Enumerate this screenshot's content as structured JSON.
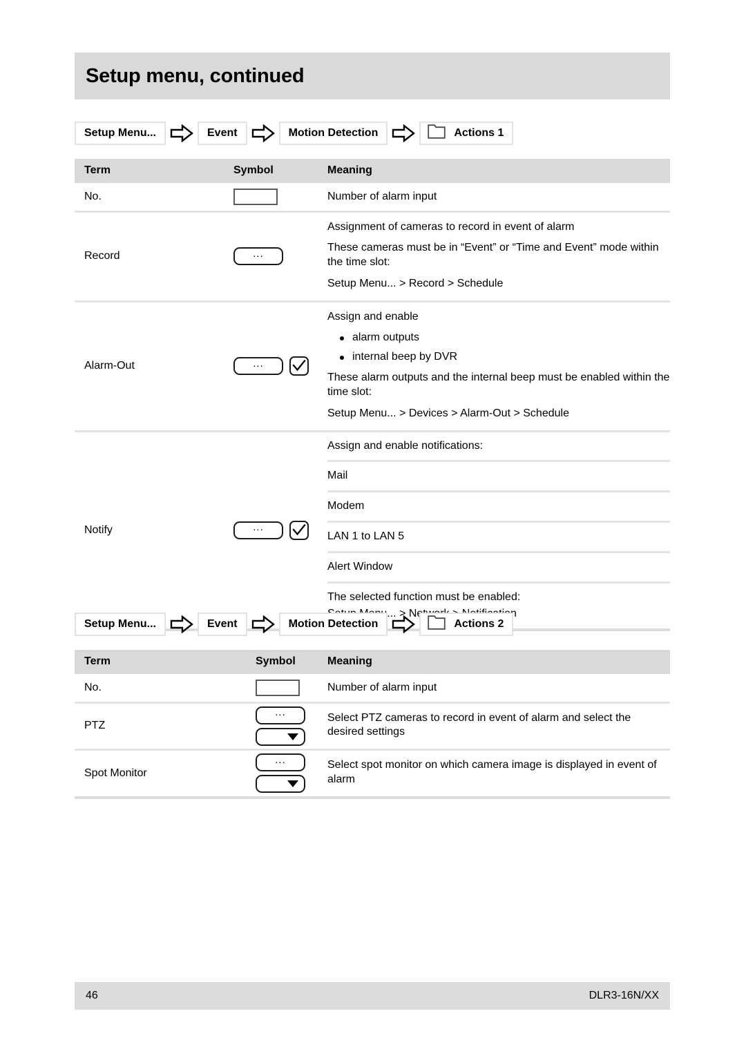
{
  "header": {
    "title": "Setup menu, continued"
  },
  "sections": [
    {
      "breadcrumb": [
        {
          "label": "Setup Menu...",
          "icon": null
        },
        {
          "label": "Event",
          "icon": null
        },
        {
          "label": "Motion Detection",
          "icon": null
        },
        {
          "label": "Actions 1",
          "icon": "folder-icon"
        }
      ],
      "columns": [
        "Term",
        "Symbol",
        "Meaning"
      ],
      "rows": [
        {
          "term": "No.",
          "symbol": [
            "box"
          ],
          "meaning_lines": [
            "Number of alarm input"
          ]
        },
        {
          "term": "Record",
          "symbol": [
            "dots"
          ],
          "meaning_lines": [
            "Assignment of cameras to record in event of alarm",
            "These cameras must be in “Event” or “Time and Event” mode within the time slot:",
            "Setup Menu... > Record > Schedule"
          ]
        },
        {
          "term": "Alarm-Out",
          "symbol": [
            "dots",
            "check"
          ],
          "meaning_lines": [
            "Assign and enable"
          ],
          "bullets": [
            "alarm outputs",
            "internal beep by DVR"
          ],
          "meaning_lines_after": [
            "These alarm outputs and the internal beep must be enabled within the time slot:",
            "Setup Menu... > Devices > Alarm-Out > Schedule"
          ]
        },
        {
          "term": "Notify",
          "symbol": [
            "dots",
            "check"
          ],
          "sub_rows": [
            "Assign and enable notifications:",
            "Mail",
            "Modem",
            "LAN 1 to LAN 5",
            "Alert Window"
          ],
          "sub_footer": [
            "The selected function must be enabled:",
            "Setup Menu... > Network > Notification"
          ]
        }
      ]
    },
    {
      "breadcrumb": [
        {
          "label": "Setup Menu...",
          "icon": null
        },
        {
          "label": "Event",
          "icon": null
        },
        {
          "label": "Motion Detection",
          "icon": null
        },
        {
          "label": "Actions 2",
          "icon": "folder-icon"
        }
      ],
      "columns": [
        "Term",
        "Symbol",
        "Meaning"
      ],
      "rows": [
        {
          "term": "No.",
          "symbol": [
            "box"
          ],
          "meaning_lines": [
            "Number of alarm input"
          ]
        },
        {
          "term": "PTZ",
          "symbol": [
            "dots",
            "dropdown"
          ],
          "meaning_lines": [
            "Select PTZ cameras to record in event of alarm and select the desired settings"
          ]
        },
        {
          "term": "Spot Monitor",
          "symbol": [
            "dots",
            "dropdown"
          ],
          "meaning_lines": [
            "Select spot monitor on which camera image is displayed in event of alarm"
          ]
        }
      ]
    }
  ],
  "footer": {
    "page_number": "46",
    "model": "DLR3-16N/XX"
  },
  "symbols": {
    "dots_label": "..."
  },
  "colors": {
    "band_grey": "#d9d9d9",
    "divider_grey": "#e4e4e4",
    "footer_grey": "#dcdcdc"
  }
}
